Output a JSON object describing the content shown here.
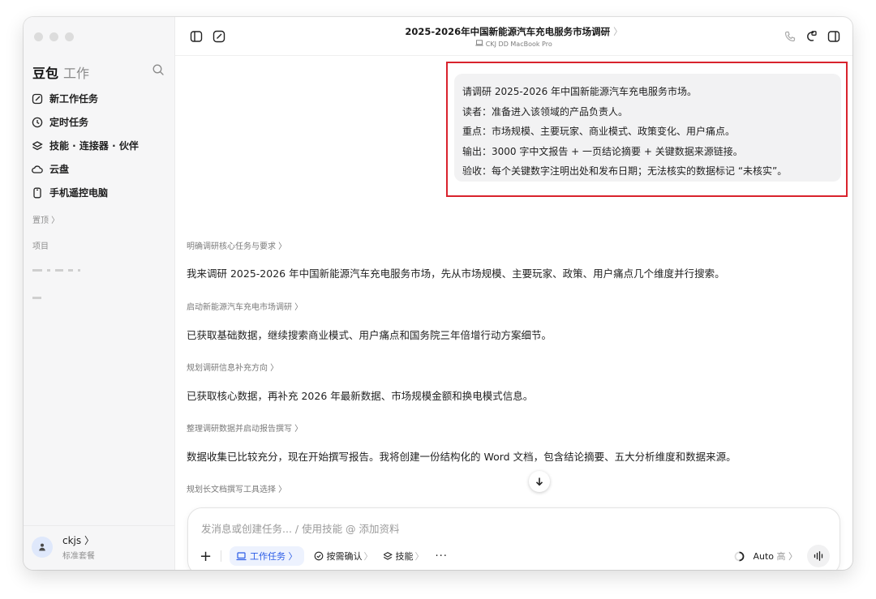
{
  "sidebar": {
    "brand": "豆包",
    "brand_sub": "工作",
    "items": [
      {
        "label": "新工作任务",
        "icon": "edit-icon"
      },
      {
        "label": "定时任务",
        "icon": "clock-icon"
      },
      {
        "label": "技能 · 连接器 · 伙伴",
        "icon": "layers-icon"
      },
      {
        "label": "云盘",
        "icon": "cloud-icon"
      },
      {
        "label": "手机遥控电脑",
        "icon": "phone-icon"
      }
    ],
    "pinned_label": "置顶 〉",
    "projects_label": "项目",
    "user": {
      "name": "ckjs 〉",
      "plan": "标准套餐"
    }
  },
  "header": {
    "title": "2025-2026年中国新能源汽车充电服务市场调研",
    "title_chevron": "〉",
    "device": "CKJ DD MacBook Pro"
  },
  "request": {
    "lines": [
      "请调研 2025-2026 年中国新能源汽车充电服务市场。",
      "读者：准备进入该领域的产品负责人。",
      "重点：市场规模、主要玩家、商业模式、政策变化、用户痛点。",
      "输出：3000 字中文报告 + 一页结论摘要 + 关键数据来源链接。",
      "验收：每个关键数字注明出处和发布日期；无法核实的数据标记 “未核实”。"
    ]
  },
  "steps": [
    {
      "label": "明确调研核心任务与要求 〉",
      "text": "我来调研 2025-2026 年中国新能源汽车充电服务市场，先从市场规模、主要玩家、政策、用户痛点几个维度并行搜索。"
    },
    {
      "label": "启动新能源汽车充电市场调研 〉",
      "text": "已获取基础数据，继续搜索商业模式、用户痛点和国务院三年倍增行动方案细节。"
    },
    {
      "label": "规划调研信息补充方向 〉",
      "text": "已获取核心数据，再补充 2026 年最新数据、市场规模金额和换电模式信息。"
    },
    {
      "label": "整理调研数据并启动报告撰写 〉",
      "text": "数据收集已比较充分，现在开始撰写报告。我将创建一份结构化的 Word 文档，包含结论摘要、五大分析维度和数据来源。"
    },
    {
      "label": "规划长文档撰写工具选择 〉",
      "text": ""
    }
  ],
  "composer": {
    "placeholder": "发消息或创建任务... / 使用技能 @ 添加资料",
    "plus": "+",
    "task_chip": "工作任务 〉",
    "confirm_chip": "按需确认",
    "skill_chip": "技能",
    "chevron": "〉",
    "more": "···",
    "model": "Auto",
    "level": "高 〉"
  },
  "colors": {
    "accent": "#2b5ce6",
    "highlight_border": "#d9232d"
  }
}
